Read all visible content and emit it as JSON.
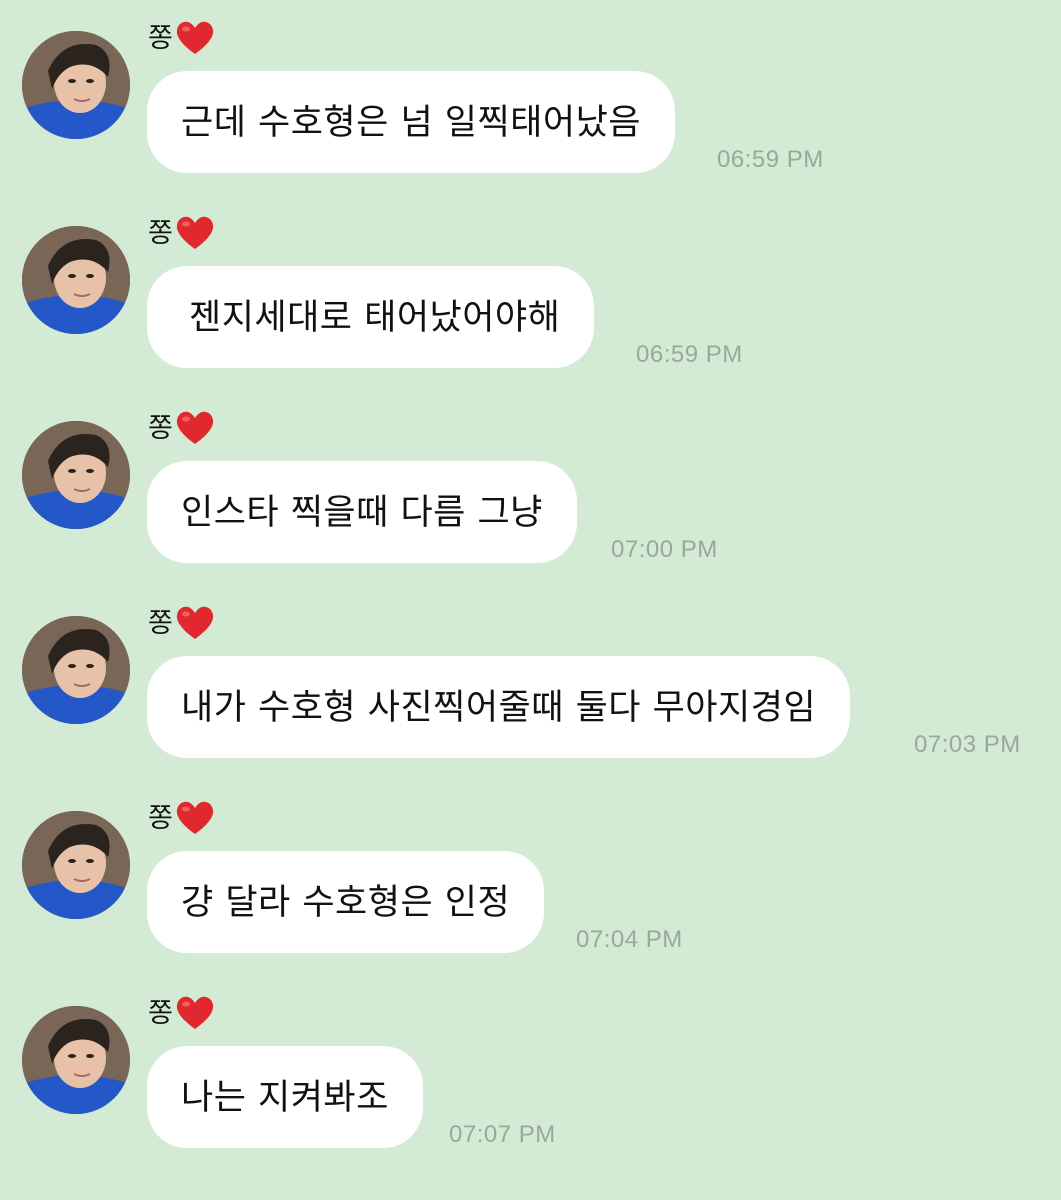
{
  "messages": [
    {
      "sender": "쫑",
      "text": "근데 수호형은 넘 일찍태어났음",
      "time": "06:59 PM"
    },
    {
      "sender": "쫑",
      "text": "젠지세대로 태어났어야해",
      "time": "06:59 PM"
    },
    {
      "sender": "쫑",
      "text": "인스타 찍을때 다름 그냥",
      "time": "07:00 PM"
    },
    {
      "sender": "쫑",
      "text": "내가 수호형 사진찍어줄때 둘다 무아지경임",
      "time": "07:03 PM"
    },
    {
      "sender": "쫑",
      "text": "걍 달라 수호형은 인정",
      "time": "07:04 PM"
    },
    {
      "sender": "쫑",
      "text": "나는 지켜봐조",
      "time": "07:07 PM"
    }
  ],
  "colors": {
    "background": "#d3ebd4",
    "bubble": "#ffffff",
    "timestamp": "#9aa89b",
    "heart": "#e0282e"
  },
  "icons": {
    "sender_badge": "red-heart-icon",
    "avatar": "profile-photo"
  }
}
